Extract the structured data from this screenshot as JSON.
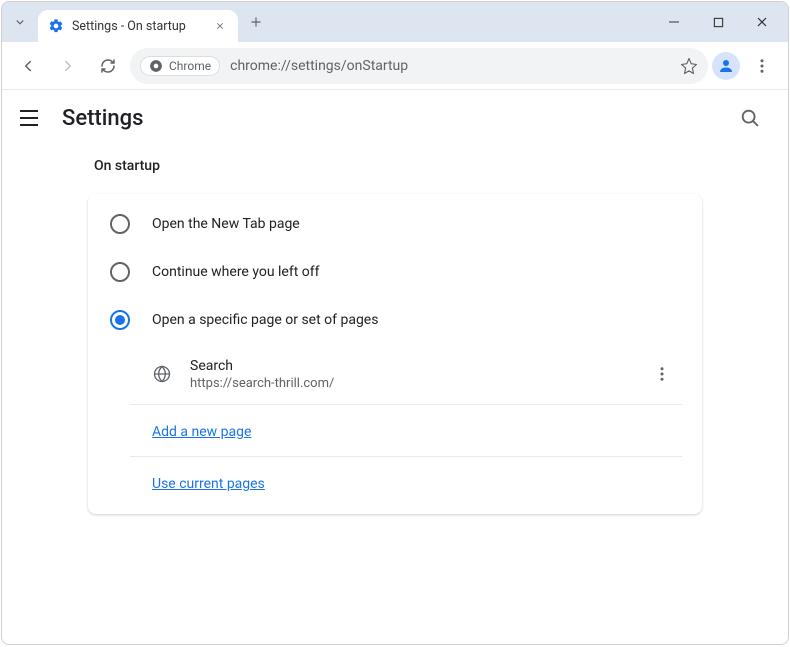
{
  "window": {
    "tab_title": "Settings - On startup"
  },
  "omnibox": {
    "chip_label": "Chrome",
    "url": "chrome://settings/onStartup"
  },
  "header": {
    "title": "Settings"
  },
  "section": {
    "title": "On startup"
  },
  "options": {
    "0": {
      "label": "Open the New Tab page"
    },
    "1": {
      "label": "Continue where you left off"
    },
    "2": {
      "label": "Open a specific page or set of pages"
    }
  },
  "page_entry": {
    "name": "Search",
    "url": "https://search-thrill.com/"
  },
  "links": {
    "add_page": "Add a new page",
    "use_current": "Use current pages"
  }
}
